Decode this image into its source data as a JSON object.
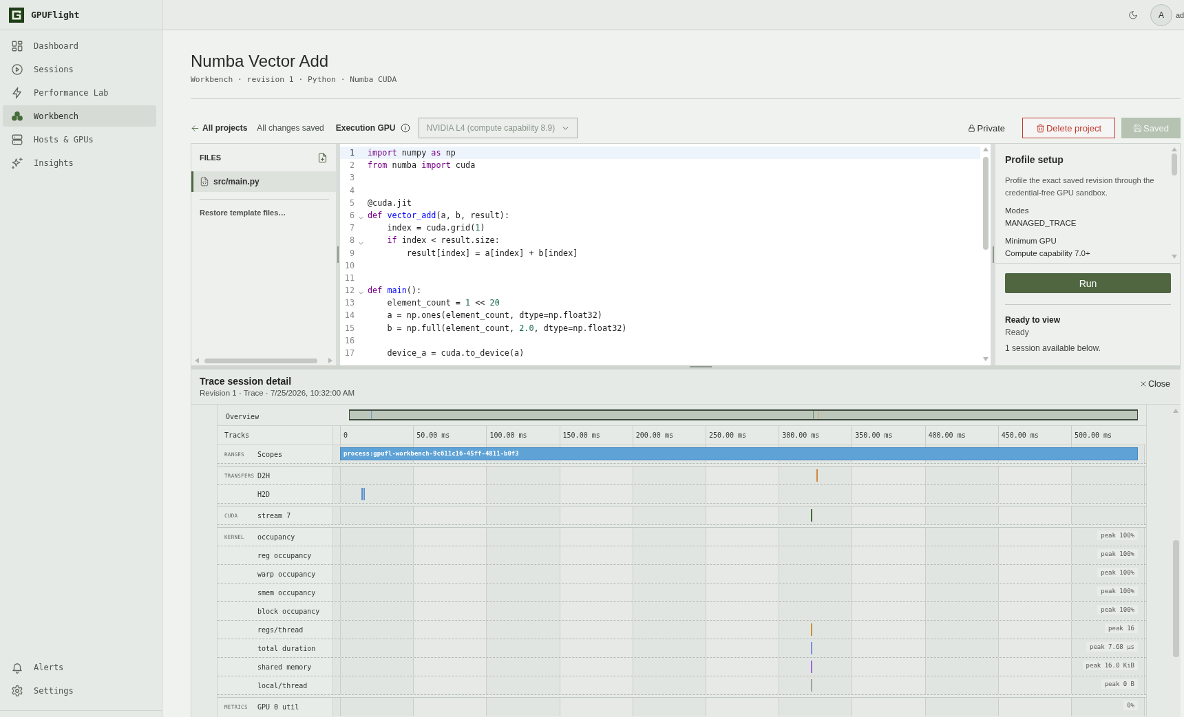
{
  "app": {
    "name": "GPUFlight"
  },
  "sidebar": {
    "items": [
      {
        "label": "Dashboard",
        "selected": false
      },
      {
        "label": "Sessions",
        "selected": false
      },
      {
        "label": "Performance Lab",
        "selected": false
      },
      {
        "label": "Workbench",
        "selected": true
      },
      {
        "label": "Hosts & GPUs",
        "selected": false
      },
      {
        "label": "Insights",
        "selected": false
      }
    ],
    "footer_items": [
      {
        "label": "Alerts",
        "selected": false
      },
      {
        "label": "Settings",
        "selected": false
      }
    ]
  },
  "header": {
    "avatar": "A",
    "user": "ad"
  },
  "page": {
    "title": "Numba Vector Add",
    "subtitle": "Workbench · revision 1 · Python · Numba CUDA"
  },
  "toolbar": {
    "back_link": "All projects",
    "save_status": "All changes saved",
    "gpu_label": "Execution GPU",
    "gpu_select": {
      "value": "NVIDIA L4 (compute capability 8.9)",
      "disabled": true
    },
    "visibility": "Private",
    "delete_button": "Delete project",
    "save_button": {
      "label": "Saved",
      "disabled": true
    }
  },
  "files": {
    "title": "FILES",
    "items": [
      {
        "name": "src/main.py",
        "selected": true
      }
    ],
    "restore_link": "Restore template files…"
  },
  "editor": {
    "lines": [
      {
        "number": "1",
        "active": true,
        "foldable": false,
        "tokens": [
          {
            "kind": "keyword",
            "text": "import"
          },
          {
            "kind": "plain",
            "text": " numpy "
          },
          {
            "kind": "keyword",
            "text": "as"
          },
          {
            "kind": "plain",
            "text": " np"
          }
        ]
      },
      {
        "number": "2",
        "active": false,
        "foldable": false,
        "tokens": [
          {
            "kind": "keyword",
            "text": "from"
          },
          {
            "kind": "plain",
            "text": " numba "
          },
          {
            "kind": "keyword",
            "text": "import"
          },
          {
            "kind": "plain",
            "text": " cuda"
          }
        ]
      },
      {
        "number": "3",
        "active": false,
        "foldable": false
      },
      {
        "number": "4",
        "active": false,
        "foldable": false
      },
      {
        "number": "5",
        "active": false,
        "foldable": false,
        "tokens": [
          {
            "kind": "plain",
            "text": "@cuda.jit"
          }
        ]
      },
      {
        "number": "6",
        "active": false,
        "foldable": true,
        "tokens": [
          {
            "kind": "keyword",
            "text": "def "
          },
          {
            "kind": "def",
            "text": "vector_add"
          },
          {
            "kind": "plain",
            "text": "(a, b, result):"
          }
        ]
      },
      {
        "number": "7",
        "active": false,
        "foldable": false,
        "tokens": [
          {
            "kind": "plain",
            "text": "    index = cuda.grid("
          },
          {
            "kind": "number",
            "text": "1"
          },
          {
            "kind": "plain",
            "text": ")"
          }
        ]
      },
      {
        "number": "8",
        "active": false,
        "foldable": true,
        "tokens": [
          {
            "kind": "keyword",
            "text": "    if"
          },
          {
            "kind": "plain",
            "text": " index < result.size:"
          }
        ]
      },
      {
        "number": "9",
        "active": false,
        "foldable": false,
        "tokens": [
          {
            "kind": "plain",
            "text": "        result[index] = a[index] + b[index]"
          }
        ]
      },
      {
        "number": "10",
        "active": false,
        "foldable": false
      },
      {
        "number": "11",
        "active": false,
        "foldable": false
      },
      {
        "number": "12",
        "active": false,
        "foldable": true,
        "tokens": [
          {
            "kind": "keyword",
            "text": "def "
          },
          {
            "kind": "def",
            "text": "main"
          },
          {
            "kind": "plain",
            "text": "():"
          }
        ]
      },
      {
        "number": "13",
        "active": false,
        "foldable": false,
        "tokens": [
          {
            "kind": "plain",
            "text": "    element_count = "
          },
          {
            "kind": "number",
            "text": "1"
          },
          {
            "kind": "plain",
            "text": " << "
          },
          {
            "kind": "number",
            "text": "20"
          }
        ]
      },
      {
        "number": "14",
        "active": false,
        "foldable": false,
        "tokens": [
          {
            "kind": "plain",
            "text": "    a = np.ones(element_count, dtype=np.float32)"
          }
        ]
      },
      {
        "number": "15",
        "active": false,
        "foldable": false,
        "tokens": [
          {
            "kind": "plain",
            "text": "    b = np.full(element_count, "
          },
          {
            "kind": "number",
            "text": "2.0"
          },
          {
            "kind": "plain",
            "text": ", dtype=np.float32)"
          }
        ]
      },
      {
        "number": "16",
        "active": false,
        "foldable": false
      },
      {
        "number": "17",
        "active": false,
        "foldable": false,
        "tokens": [
          {
            "kind": "plain",
            "text": "    device_a = cuda.to_device(a)"
          }
        ]
      }
    ]
  },
  "profile": {
    "title": "Profile setup",
    "description": "Profile the exact saved revision through the credential-free GPU sandbox.",
    "fields": [
      {
        "label": "Modes",
        "value": "MANAGED_TRACE"
      },
      {
        "label": "Minimum GPU",
        "value": "Compute capability 7.0+"
      }
    ],
    "run_button": "Run",
    "status": {
      "title": "Ready to view",
      "state": "Ready",
      "note": "1 session available below."
    }
  },
  "trace": {
    "title": "Trace session detail",
    "subtitle": "Revision 1 · Trace · 7/25/2026, 10:32:00 AM",
    "close": "Close",
    "overview": {
      "label": "Overview",
      "marks": [
        {
          "color": "#6b9ad0",
          "level": 0.027
        },
        {
          "color": "#6d8f5f",
          "level": 0.588
        },
        {
          "color": "#d8a86a",
          "level": 0.595
        }
      ]
    },
    "axis": {
      "label": "Tracks",
      "ticks": [
        "0",
        "50.00 ms",
        "100.00 ms",
        "150.00 ms",
        "200.00 ms",
        "250.00 ms",
        "300.00 ms",
        "350.00 ms",
        "400.00 ms",
        "450.00 ms",
        "500.00 ms"
      ]
    },
    "groups": [
      {
        "name": "RANGES",
        "tracks": [
          {
            "label": "Scopes",
            "kind": "range",
            "bar": {
              "label": "process:gpufl-workbench-9c611c16-45ff-4811-b0f3",
              "level": 0.99
            }
          }
        ]
      },
      {
        "name": "TRANSFERS",
        "tracks": [
          {
            "label": "D2H",
            "kind": "events",
            "marks": [
              {
                "color": "#d0883a",
                "level": 0.591
              }
            ]
          },
          {
            "label": "H2D",
            "kind": "events",
            "marks": [
              {
                "color": "#5b8fd0",
                "level": 0.0262
              },
              {
                "color": "#5b8fd0",
                "level": 0.0292
              }
            ]
          }
        ]
      },
      {
        "name": "CUDA",
        "tracks": [
          {
            "label": "stream 7",
            "kind": "events",
            "marks": [
              {
                "color": "#3d6b35",
                "level": 0.584
              }
            ]
          }
        ]
      },
      {
        "name": "KERNEL",
        "tracks": [
          {
            "label": "occupancy",
            "kind": "events",
            "peak": "peak 100%"
          },
          {
            "label": "reg occupancy",
            "kind": "events",
            "peak": "peak 100%"
          },
          {
            "label": "warp occupancy",
            "kind": "events",
            "peak": "peak 100%"
          },
          {
            "label": "smem occupancy",
            "kind": "events",
            "peak": "peak 100%"
          },
          {
            "label": "block occupancy",
            "kind": "events",
            "peak": "peak 100%"
          },
          {
            "label": "regs/thread",
            "kind": "events",
            "peak": "peak 16",
            "marks": [
              {
                "color": "#c8922a",
                "level": 0.584
              }
            ]
          },
          {
            "label": "total duration",
            "kind": "events",
            "peak": "peak 7.68 µs",
            "marks": [
              {
                "color": "#7b8fdc",
                "level": 0.584
              }
            ]
          },
          {
            "label": "shared memory",
            "kind": "events",
            "peak": "peak 16.0 KiB",
            "marks": [
              {
                "color": "#9a6ad8",
                "level": 0.584
              }
            ]
          },
          {
            "label": "local/thread",
            "kind": "events",
            "peak": "peak 0 B",
            "marks": [
              {
                "color": "#a3a3a3",
                "level": 0.584
              }
            ]
          }
        ]
      },
      {
        "name": "METRICS",
        "tracks": [
          {
            "label": "GPU 0 util",
            "kind": "events",
            "peak": "0%"
          }
        ]
      }
    ]
  }
}
